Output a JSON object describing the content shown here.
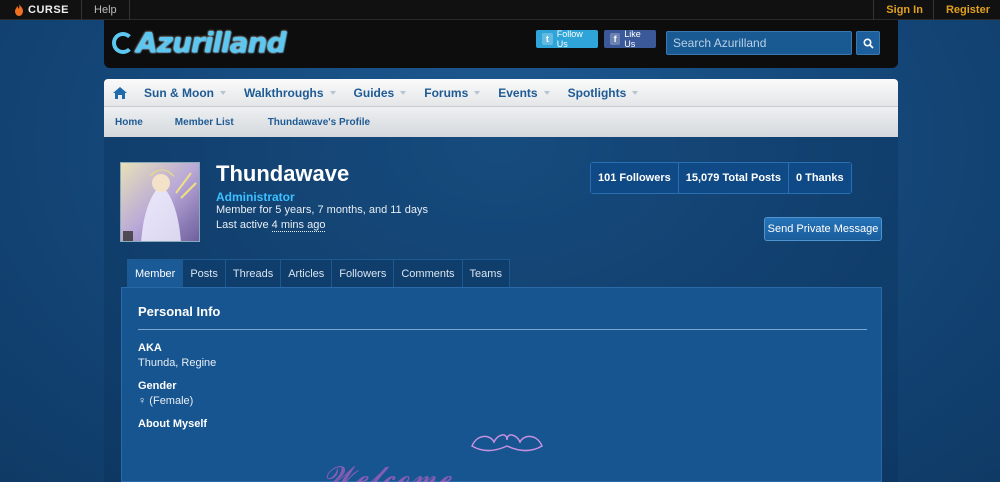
{
  "topbar": {
    "brand": "CURSE",
    "help": "Help",
    "sign_in": "Sign In",
    "register": "Register"
  },
  "header": {
    "logo_text": "Azurilland",
    "twitter_label": "Follow Us",
    "facebook_label": "Like Us",
    "search_placeholder": "Search Azurilland"
  },
  "nav": {
    "items": [
      {
        "label": "Sun & Moon"
      },
      {
        "label": "Walkthroughs"
      },
      {
        "label": "Guides"
      },
      {
        "label": "Forums"
      },
      {
        "label": "Events"
      },
      {
        "label": "Spotlights"
      }
    ]
  },
  "breadcrumb": [
    "Home",
    "Member List",
    "Thundawave's Profile"
  ],
  "profile": {
    "name": "Thundawave",
    "role": "Administrator",
    "member_for": "Member for 5 years, 7 months, and 11 days",
    "last_active_prefix": "Last active ",
    "last_active_time": "4 mins ago",
    "stats": [
      "101 Followers",
      "15,079 Total Posts",
      "0 Thanks"
    ],
    "pm_button": "Send Private Message"
  },
  "tabs": [
    "Member",
    "Posts",
    "Threads",
    "Articles",
    "Followers",
    "Comments",
    "Teams"
  ],
  "personal_info": {
    "heading": "Personal Info",
    "aka_label": "AKA",
    "aka_value": "Thunda, Regine",
    "gender_label": "Gender",
    "gender_value": "♀ (Female)",
    "about_label": "About Myself"
  },
  "colors": {
    "accent": "#3cc0ff",
    "link": "#1e5b95",
    "topbar_link": "#e0a020",
    "background": "#164c7e"
  }
}
